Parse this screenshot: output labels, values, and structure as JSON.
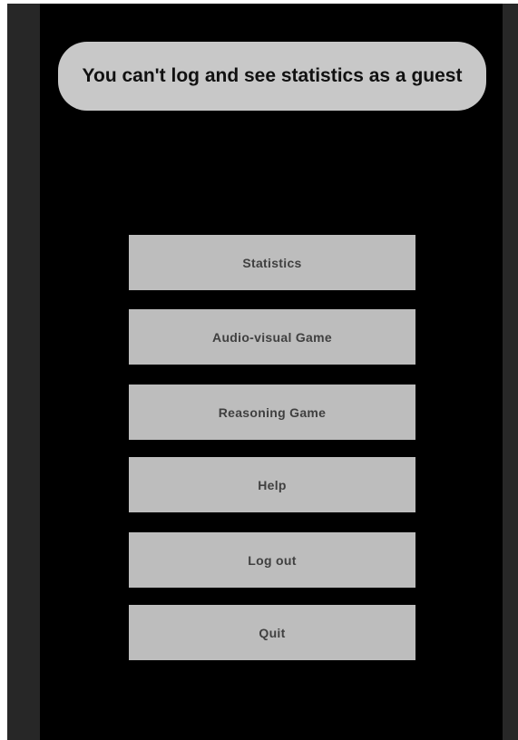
{
  "toast": {
    "message": "You can't log and see statistics as a guest"
  },
  "menu": {
    "buttons": [
      {
        "label": "Statistics"
      },
      {
        "label": "Audio-visual Game"
      },
      {
        "label": "Reasoning Game"
      },
      {
        "label": "Help"
      },
      {
        "label": "Log out"
      },
      {
        "label": "Quit"
      }
    ]
  },
  "colors": {
    "background": "#000000",
    "side_panel": "#272727",
    "button": "#bdbdbd",
    "toast": "#c8c8c8"
  }
}
